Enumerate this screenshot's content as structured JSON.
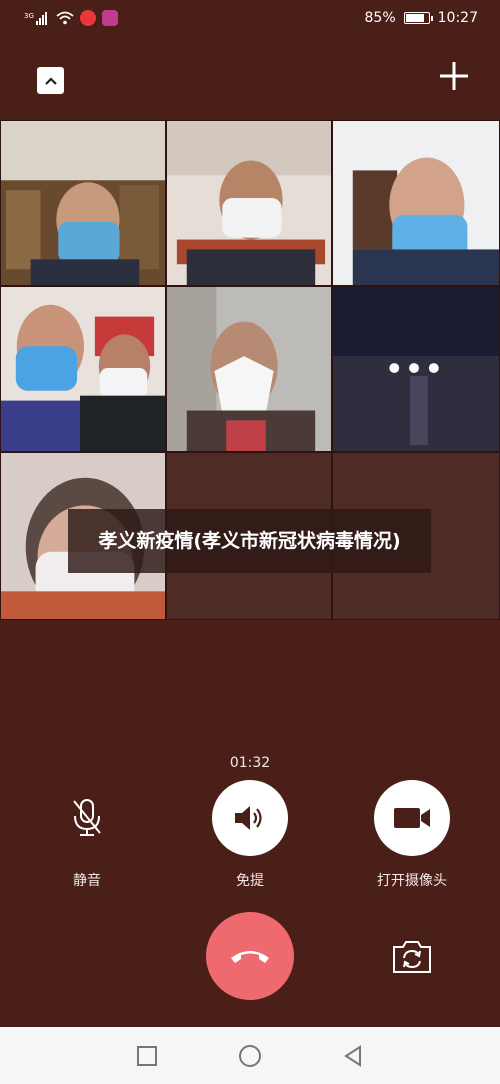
{
  "status_bar": {
    "network": "3G",
    "battery_percent": "85%",
    "battery_level": 0.85,
    "time": "10:27"
  },
  "call": {
    "banner_text": "孝义新疫情(孝义市新冠状病毒情况)",
    "timer": "01:32",
    "participants_shown": 7
  },
  "controls": {
    "mute_label": "静音",
    "speaker_label": "免提",
    "camera_label": "打开摄像头"
  },
  "icons": {
    "collapse": "chevron-up-icon",
    "add": "plus-icon",
    "mute": "microphone-off-icon",
    "speaker": "speaker-icon",
    "camera": "video-camera-icon",
    "hangup": "phone-hangup-icon",
    "flip": "camera-flip-icon",
    "nav_recent": "square-icon",
    "nav_home": "circle-icon",
    "nav_back": "triangle-back-icon"
  },
  "colors": {
    "background": "#4a1f18",
    "hangup": "#ef6a6f",
    "control_circle": "#ffffff"
  }
}
